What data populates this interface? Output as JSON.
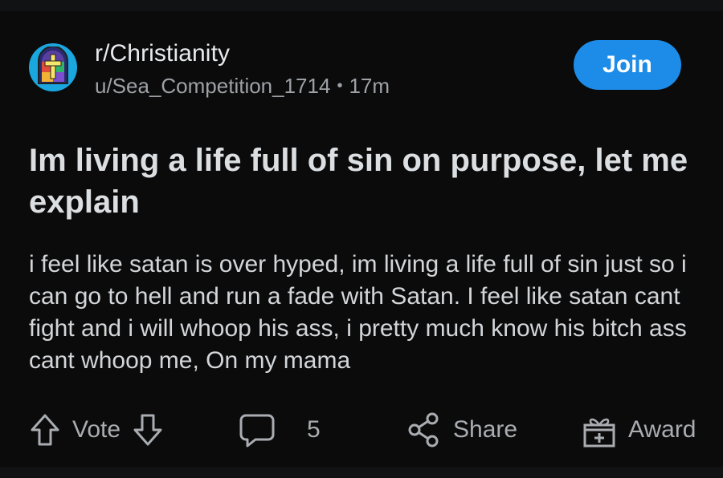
{
  "post": {
    "subreddit": "r/Christianity",
    "author": "u/Sea_Competition_1714",
    "separator": "•",
    "age": "17m",
    "join_label": "Join",
    "title": "Im living a life full of sin on purpose, let me explain",
    "body": "i feel like satan is over hyped, im living a life full of sin just so i can go to hell and run a fade with Satan. I feel like satan cant fight and i will whoop his ass, i pretty much know his bitch ass cant whoop me, On my mama"
  },
  "actions": {
    "vote_label": "Vote",
    "comment_count": "5",
    "share_label": "Share",
    "award_label": "Award"
  },
  "icons": {
    "avatar": "stained-glass-cross-icon",
    "upvote": "arrow-up-icon",
    "downvote": "arrow-down-icon",
    "comment": "comment-bubble-icon",
    "share": "share-icon",
    "award": "gift-icon"
  },
  "colors": {
    "background": "#0b0b0c",
    "accent": "#1c8ce8",
    "avatar_bg": "#1aa7e0"
  }
}
